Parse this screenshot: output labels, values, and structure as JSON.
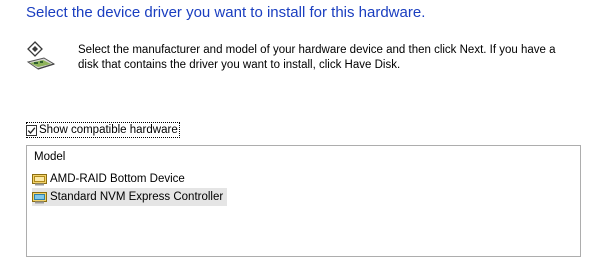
{
  "header": {
    "title": "Select the device driver you want to install for this hardware."
  },
  "instructions": {
    "line1": "Select the manufacturer and model of your hardware device and then click Next. If you have a",
    "line2": "disk that contains the driver you want to install, click Have Disk.",
    "icon": "hardware-card-icon"
  },
  "compatible": {
    "label": "Show compatible hardware",
    "checked": true
  },
  "model_list": {
    "column_header": "Model",
    "items": [
      {
        "label": "AMD-RAID Bottom Device",
        "icon": "driver-icon",
        "selected": false
      },
      {
        "label": "Standard NVM Express Controller",
        "icon": "driver-icon",
        "selected": true
      }
    ]
  },
  "colors": {
    "title": "#1a3ec0",
    "selection": "#e5e5e5",
    "list_border": "#adadad"
  }
}
